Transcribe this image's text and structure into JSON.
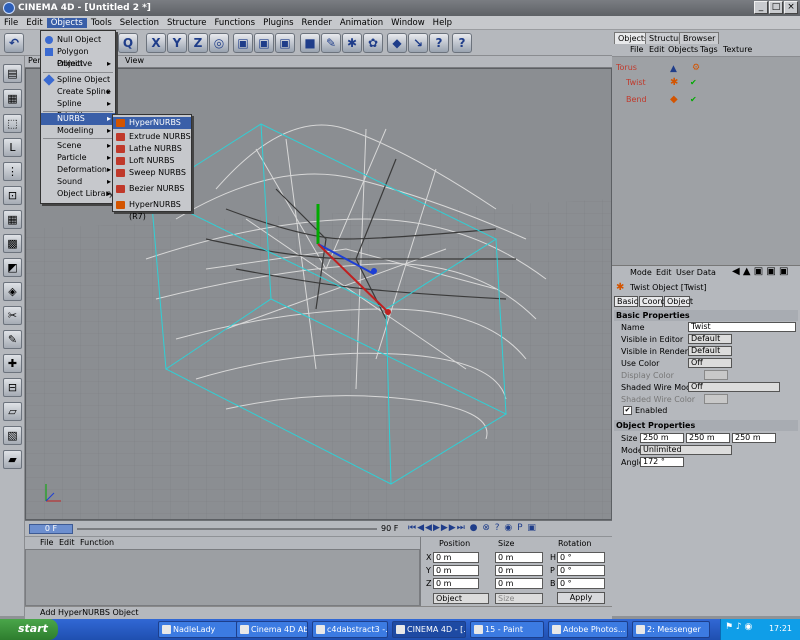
{
  "window": {
    "title": "CINEMA 4D - [Untitled 2 *]"
  },
  "menubar": [
    "File",
    "Edit",
    "Objects",
    "Tools",
    "Selection",
    "Structure",
    "Functions",
    "Plugins",
    "Render",
    "Animation",
    "Window",
    "Help"
  ],
  "viewport": {
    "menu": [
      "Per",
      "View"
    ],
    "frame_field": "0 F",
    "end_frame": "90 F"
  },
  "objects_menu": {
    "items": [
      {
        "label": "Null Object"
      },
      {
        "label": "Polygon Object"
      },
      {
        "label": "Primitive",
        "submenu": true
      },
      {
        "label": "Spline Object"
      },
      {
        "label": "Create Spline",
        "submenu": true
      },
      {
        "label": "Spline Primitive",
        "submenu": true
      },
      {
        "label": "NURBS",
        "submenu": true,
        "highlighted": true
      },
      {
        "label": "Modeling",
        "submenu": true
      },
      {
        "label": "Scene",
        "submenu": true
      },
      {
        "label": "Particle",
        "submenu": true
      },
      {
        "label": "Deformation",
        "submenu": true
      },
      {
        "label": "Sound",
        "submenu": true
      },
      {
        "label": "Object Library",
        "submenu": true
      }
    ]
  },
  "nurbs_submenu": {
    "items": [
      {
        "label": "HyperNURBS",
        "highlighted": true
      },
      {
        "label": "Extrude NURBS"
      },
      {
        "label": "Lathe NURBS"
      },
      {
        "label": "Loft NURBS"
      },
      {
        "label": "Sweep NURBS"
      },
      {
        "label": "Bezier NURBS"
      },
      {
        "label": "HyperNURBS (R7)"
      }
    ]
  },
  "right_tabs": [
    "Objects",
    "Structure",
    "Browser"
  ],
  "obj_menu": [
    "File",
    "Edit",
    "Objects",
    "Tags",
    "Texture"
  ],
  "object_tree": [
    {
      "name": "Torus",
      "color": "#c0392b"
    },
    {
      "name": "Twist",
      "color": "#c0392b"
    },
    {
      "name": "Bend",
      "color": "#c0392b"
    }
  ],
  "attr_menu": [
    "Mode",
    "Edit",
    "User Data"
  ],
  "attributes": {
    "object_title": "Twist Object [Twist]",
    "tabs": [
      "Basic",
      "Coord.",
      "Object"
    ],
    "basic_header": "Basic Properties",
    "name_label": "Name",
    "name_value": "Twist",
    "vis_editor_label": "Visible in Editor",
    "vis_editor_value": "Default",
    "vis_render_label": "Visible in Renderer",
    "vis_render_value": "Default",
    "use_color_label": "Use Color",
    "use_color_value": "Off",
    "display_color_label": "Display Color",
    "shaded_wire_mode_label": "Shaded Wire Mode",
    "shaded_wire_mode_value": "Off",
    "shaded_wire_color_label": "Shaded Wire Color",
    "enabled_label": "Enabled",
    "object_header": "Object Properties",
    "size_label": "Size",
    "size_x": "250 m",
    "size_y": "250 m",
    "size_z": "250 m",
    "mode_label": "Mode",
    "mode_value": "Unlimited",
    "angle_label": "Angle",
    "angle_value": "172 °"
  },
  "material_menu": [
    "File",
    "Edit",
    "Function"
  ],
  "coords": {
    "headers": [
      "Position",
      "Size",
      "Rotation"
    ],
    "axes_pos": [
      "X",
      "Y",
      "Z"
    ],
    "axes_rot": [
      "H",
      "P",
      "B"
    ],
    "pos": [
      "0 m",
      "0 m",
      "0 m"
    ],
    "size": [
      "0 m",
      "0 m",
      "0 m"
    ],
    "rot": [
      "0 °",
      "0 °",
      "0 °"
    ],
    "mode_select": "Object",
    "size_select": "Size",
    "apply": "Apply"
  },
  "statusbar": "Add HyperNURBS Object",
  "taskbar": {
    "start": "start",
    "tasks": [
      "NadleLady",
      "Cinema 4D Ab...",
      "c4dabstract3 -...",
      "CINEMA 4D - [...",
      "15 - Paint",
      "Adobe Photos...",
      "2: Messenger"
    ],
    "clock": "17:21"
  }
}
